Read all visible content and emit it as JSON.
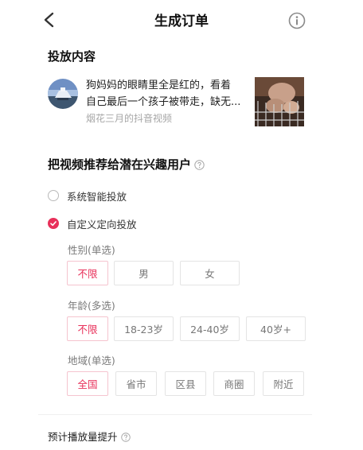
{
  "header": {
    "title": "生成订单"
  },
  "content_section": {
    "title": "投放内容",
    "video": {
      "line1": "狗妈妈的眼睛里全是红的，看着",
      "line2": "自己最后一个孩子被带走，缺无...",
      "author": "烟花三月的抖音视频"
    }
  },
  "target_section": {
    "title": "把视频推荐给潜在兴趣用户",
    "options": [
      {
        "label": "系统智能投放",
        "selected": false
      },
      {
        "label": "自定义定向投放",
        "selected": true
      }
    ]
  },
  "gender": {
    "label": "性别(单选)",
    "chips": [
      "不限",
      "男",
      "女"
    ],
    "selected": "不限"
  },
  "age": {
    "label": "年龄(多选)",
    "chips": [
      "不限",
      "18-23岁",
      "24-40岁",
      "40岁+"
    ],
    "selected": "不限"
  },
  "region": {
    "label": "地域(单选)",
    "chips": [
      "全国",
      "省市",
      "区县",
      "商圈",
      "附近"
    ],
    "selected": "全国"
  },
  "estimate_section": {
    "title": "预计播放量提升"
  },
  "colors": {
    "accent": "#e8305a",
    "chip_border": "#e4e4e4",
    "muted": "#a6a6a6"
  },
  "icons": {
    "back": "chevron-left-icon",
    "info": "info-circle-icon",
    "help": "question-circle-icon",
    "check": "check-icon"
  }
}
